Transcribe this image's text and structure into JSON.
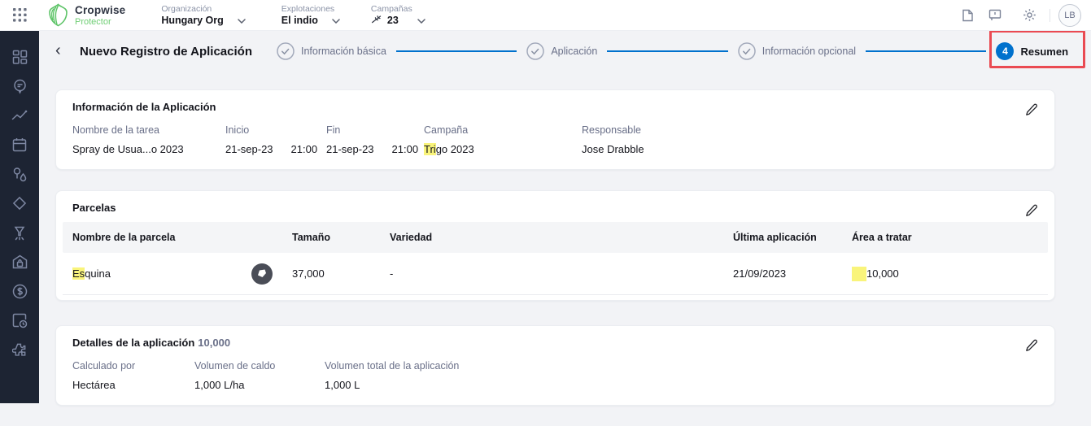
{
  "topbar": {
    "brand": "Cropwise",
    "product": "Protector",
    "selectors": [
      {
        "label": "Organización",
        "value": "Hungary Org"
      },
      {
        "label": "Explotaciones",
        "value": "El indio"
      },
      {
        "label": "Campañas",
        "value": "23"
      }
    ],
    "avatar_initials": "LB"
  },
  "header": {
    "back": "‹",
    "title": "Nuevo Registro de Aplicación",
    "steps": [
      {
        "label": "Información básica",
        "state": "done"
      },
      {
        "label": "Aplicación",
        "state": "done"
      },
      {
        "label": "Información opcional",
        "state": "done"
      },
      {
        "label": "Resumen",
        "state": "current",
        "number": "4"
      }
    ]
  },
  "info_card": {
    "title": "Información de la Aplicación",
    "fields": {
      "task": {
        "label": "Nombre de la tarea",
        "value": "Spray de Usua...o 2023"
      },
      "start": {
        "label": "Inicio",
        "date": "21-sep-23",
        "time": "21:00"
      },
      "end": {
        "label": "Fin",
        "date": "21-sep-23",
        "time": "21:00"
      },
      "campaign": {
        "label": "Campaña",
        "value_highlight": "Tri",
        "value_rest": "go 2023"
      },
      "responsible": {
        "label": "Responsable",
        "value": "Jose Drabble"
      }
    }
  },
  "parcels_card": {
    "title": "Parcelas",
    "columns": {
      "name": "Nombre de la parcela",
      "size": "Tamaño",
      "variety": "Variedad",
      "last_application": "Última aplicación",
      "area_to_treat": "Área a tratar"
    },
    "row": {
      "name_highlight": "Es",
      "name_rest": "quina",
      "size": "37,000",
      "variety": "-",
      "last_application": "21/09/2023",
      "area_to_treat": "10,000"
    }
  },
  "details_card": {
    "title": "Detalles de la aplicación",
    "title_suffix": "10,000",
    "fields": {
      "calculated_by": {
        "label": "Calculado por",
        "value": "Hectárea"
      },
      "mix_volume": {
        "label": "Volumen de caldo",
        "value": "1,000 L/ha"
      },
      "total_volume": {
        "label": "Volumen total de la aplicación",
        "value": "1,000 L"
      }
    }
  },
  "colors": {
    "accent_blue": "#0071cd",
    "brand_green": "#6fce74",
    "sidebar_bg": "#1d2433",
    "annotation_red": "#ea4a52",
    "highlight_yellow": "#f9f47b"
  }
}
